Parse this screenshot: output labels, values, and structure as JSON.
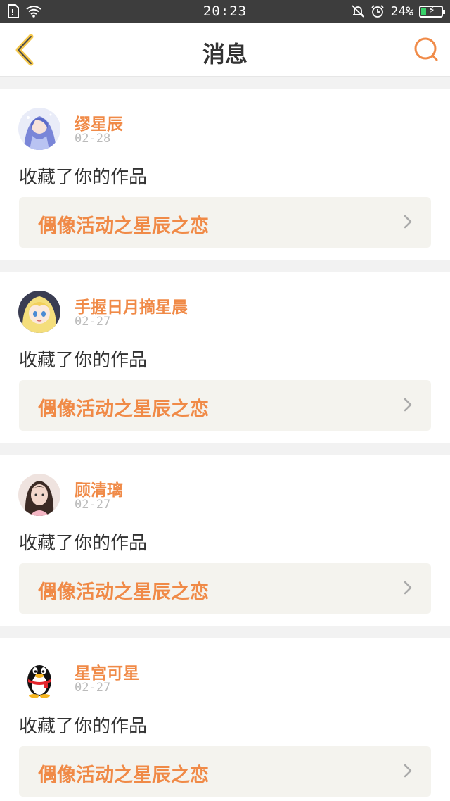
{
  "status_bar": {
    "time": "20:23",
    "battery": "24%",
    "battery_level": 0.24,
    "battery_color": "#38d26a"
  },
  "header": {
    "title": "消息",
    "accent_color": "#f08a47"
  },
  "messages": [
    {
      "user": "缪星辰",
      "date": "02-28",
      "action": "收藏了你的作品",
      "work": "偶像活动之星辰之恋",
      "avatar_icon": "anime-girl-blue-icon"
    },
    {
      "user": "手握日月摘星晨",
      "date": "02-27",
      "action": "收藏了你的作品",
      "work": "偶像活动之星辰之恋",
      "avatar_icon": "anime-girl-blonde-icon"
    },
    {
      "user": "顾清璃",
      "date": "02-27",
      "action": "收藏了你的作品",
      "work": "偶像活动之星辰之恋",
      "avatar_icon": "photo-girl-icon"
    },
    {
      "user": "星宫可星",
      "date": "02-27",
      "action": "收藏了你的作品",
      "work": "偶像活动之星辰之恋",
      "avatar_icon": "qq-penguin-icon"
    }
  ]
}
